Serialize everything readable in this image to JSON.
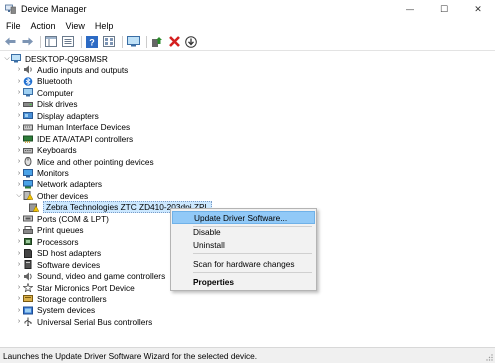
{
  "window": {
    "title": "Device Manager",
    "minimize_glyph": "—",
    "maximize_glyph": "☐",
    "close_glyph": "✕"
  },
  "menu": [
    "File",
    "Action",
    "View",
    "Help"
  ],
  "toolbar": {
    "buttons": [
      "back-arrow-icon",
      "forward-arrow-icon",
      "show-hide-tree-icon",
      "properties-icon",
      "help-icon",
      "view-icon",
      "monitor-icon",
      "update-driver-icon",
      "uninstall-red-x-icon",
      "download-arrow-icon"
    ]
  },
  "tree": {
    "root": "DESKTOP-Q9G8MSR",
    "categories": [
      {
        "label": "Audio inputs and outputs",
        "icon": "speaker-icon",
        "expanded": false
      },
      {
        "label": "Bluetooth",
        "icon": "bluetooth-icon",
        "expanded": false
      },
      {
        "label": "Computer",
        "icon": "computer-icon",
        "expanded": false
      },
      {
        "label": "Disk drives",
        "icon": "disk-icon",
        "expanded": false
      },
      {
        "label": "Display adapters",
        "icon": "display-adapter-icon",
        "expanded": false
      },
      {
        "label": "Human Interface Devices",
        "icon": "hid-icon",
        "expanded": false
      },
      {
        "label": "IDE ATA/ATAPI controllers",
        "icon": "ide-icon",
        "expanded": false
      },
      {
        "label": "Keyboards",
        "icon": "keyboard-icon",
        "expanded": false
      },
      {
        "label": "Mice and other pointing devices",
        "icon": "mouse-icon",
        "expanded": false
      },
      {
        "label": "Monitors",
        "icon": "monitor-icon",
        "expanded": false
      },
      {
        "label": "Network adapters",
        "icon": "network-icon",
        "expanded": false
      },
      {
        "label": "Other devices",
        "icon": "other-devices-icon",
        "expanded": true
      },
      {
        "label": "Zebra Technologies ZTC ZD410-203dpi ZPL",
        "icon": "unknown-device-warning-icon",
        "child": true,
        "selected": true
      },
      {
        "label": "Ports (COM & LPT)",
        "icon": "port-icon",
        "expanded": false
      },
      {
        "label": "Print queues",
        "icon": "printer-icon",
        "expanded": false
      },
      {
        "label": "Processors",
        "icon": "processor-icon",
        "expanded": false
      },
      {
        "label": "SD host adapters",
        "icon": "sd-icon",
        "expanded": false
      },
      {
        "label": "Software devices",
        "icon": "software-icon",
        "expanded": false
      },
      {
        "label": "Sound, video and game controllers",
        "icon": "sound-icon",
        "expanded": false
      },
      {
        "label": "Star Micronics Port Device",
        "icon": "star-port-icon",
        "expanded": false
      },
      {
        "label": "Storage controllers",
        "icon": "storage-icon",
        "expanded": false
      },
      {
        "label": "System devices",
        "icon": "system-icon",
        "expanded": false
      },
      {
        "label": "Universal Serial Bus controllers",
        "icon": "usb-icon",
        "expanded": false
      }
    ]
  },
  "context_menu": {
    "items": [
      {
        "label": "Update Driver Software...",
        "highlighted": true
      },
      {
        "label": "Disable"
      },
      {
        "label": "Uninstall"
      },
      {
        "label": "Scan for hardware changes"
      },
      {
        "label": "Properties",
        "bold": true
      }
    ]
  },
  "status": "Launches the Update Driver Software Wizard for the selected device.",
  "colors": {
    "selection": "#cce8ff",
    "menu_highlight": "#91c9f7",
    "uninstall_red": "#d41f1f",
    "update_green": "#2a8a2a"
  }
}
